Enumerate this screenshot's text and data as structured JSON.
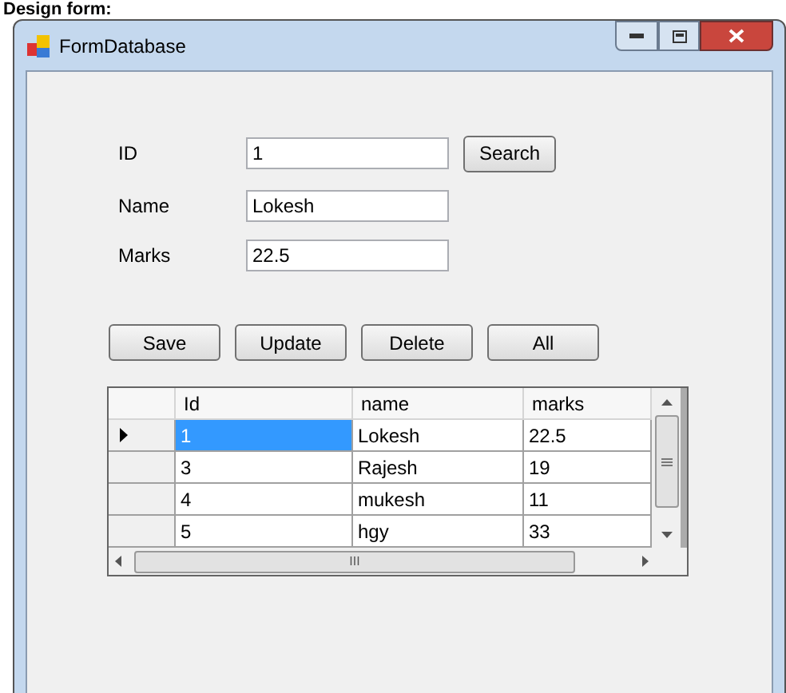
{
  "heading": "Design form:",
  "window": {
    "title": "FormDatabase"
  },
  "fields": [
    {
      "label": "ID",
      "value": "1"
    },
    {
      "label": "Name",
      "value": "Lokesh"
    },
    {
      "label": "Marks",
      "value": "22.5"
    }
  ],
  "search_button": "Search",
  "buttons": [
    "Save",
    "Update",
    "Delete",
    "All"
  ],
  "table": {
    "columns": [
      "Id",
      "name",
      "marks"
    ],
    "rows": [
      {
        "cells": [
          "1",
          "Lokesh",
          "22.5"
        ],
        "selected": true
      },
      {
        "cells": [
          "3",
          "Rajesh",
          "19"
        ],
        "selected": false
      },
      {
        "cells": [
          "4",
          "mukesh",
          "11"
        ],
        "selected": false
      },
      {
        "cells": [
          "5",
          "hgy",
          "33"
        ],
        "selected": false
      }
    ]
  },
  "scroll_grip": "III"
}
